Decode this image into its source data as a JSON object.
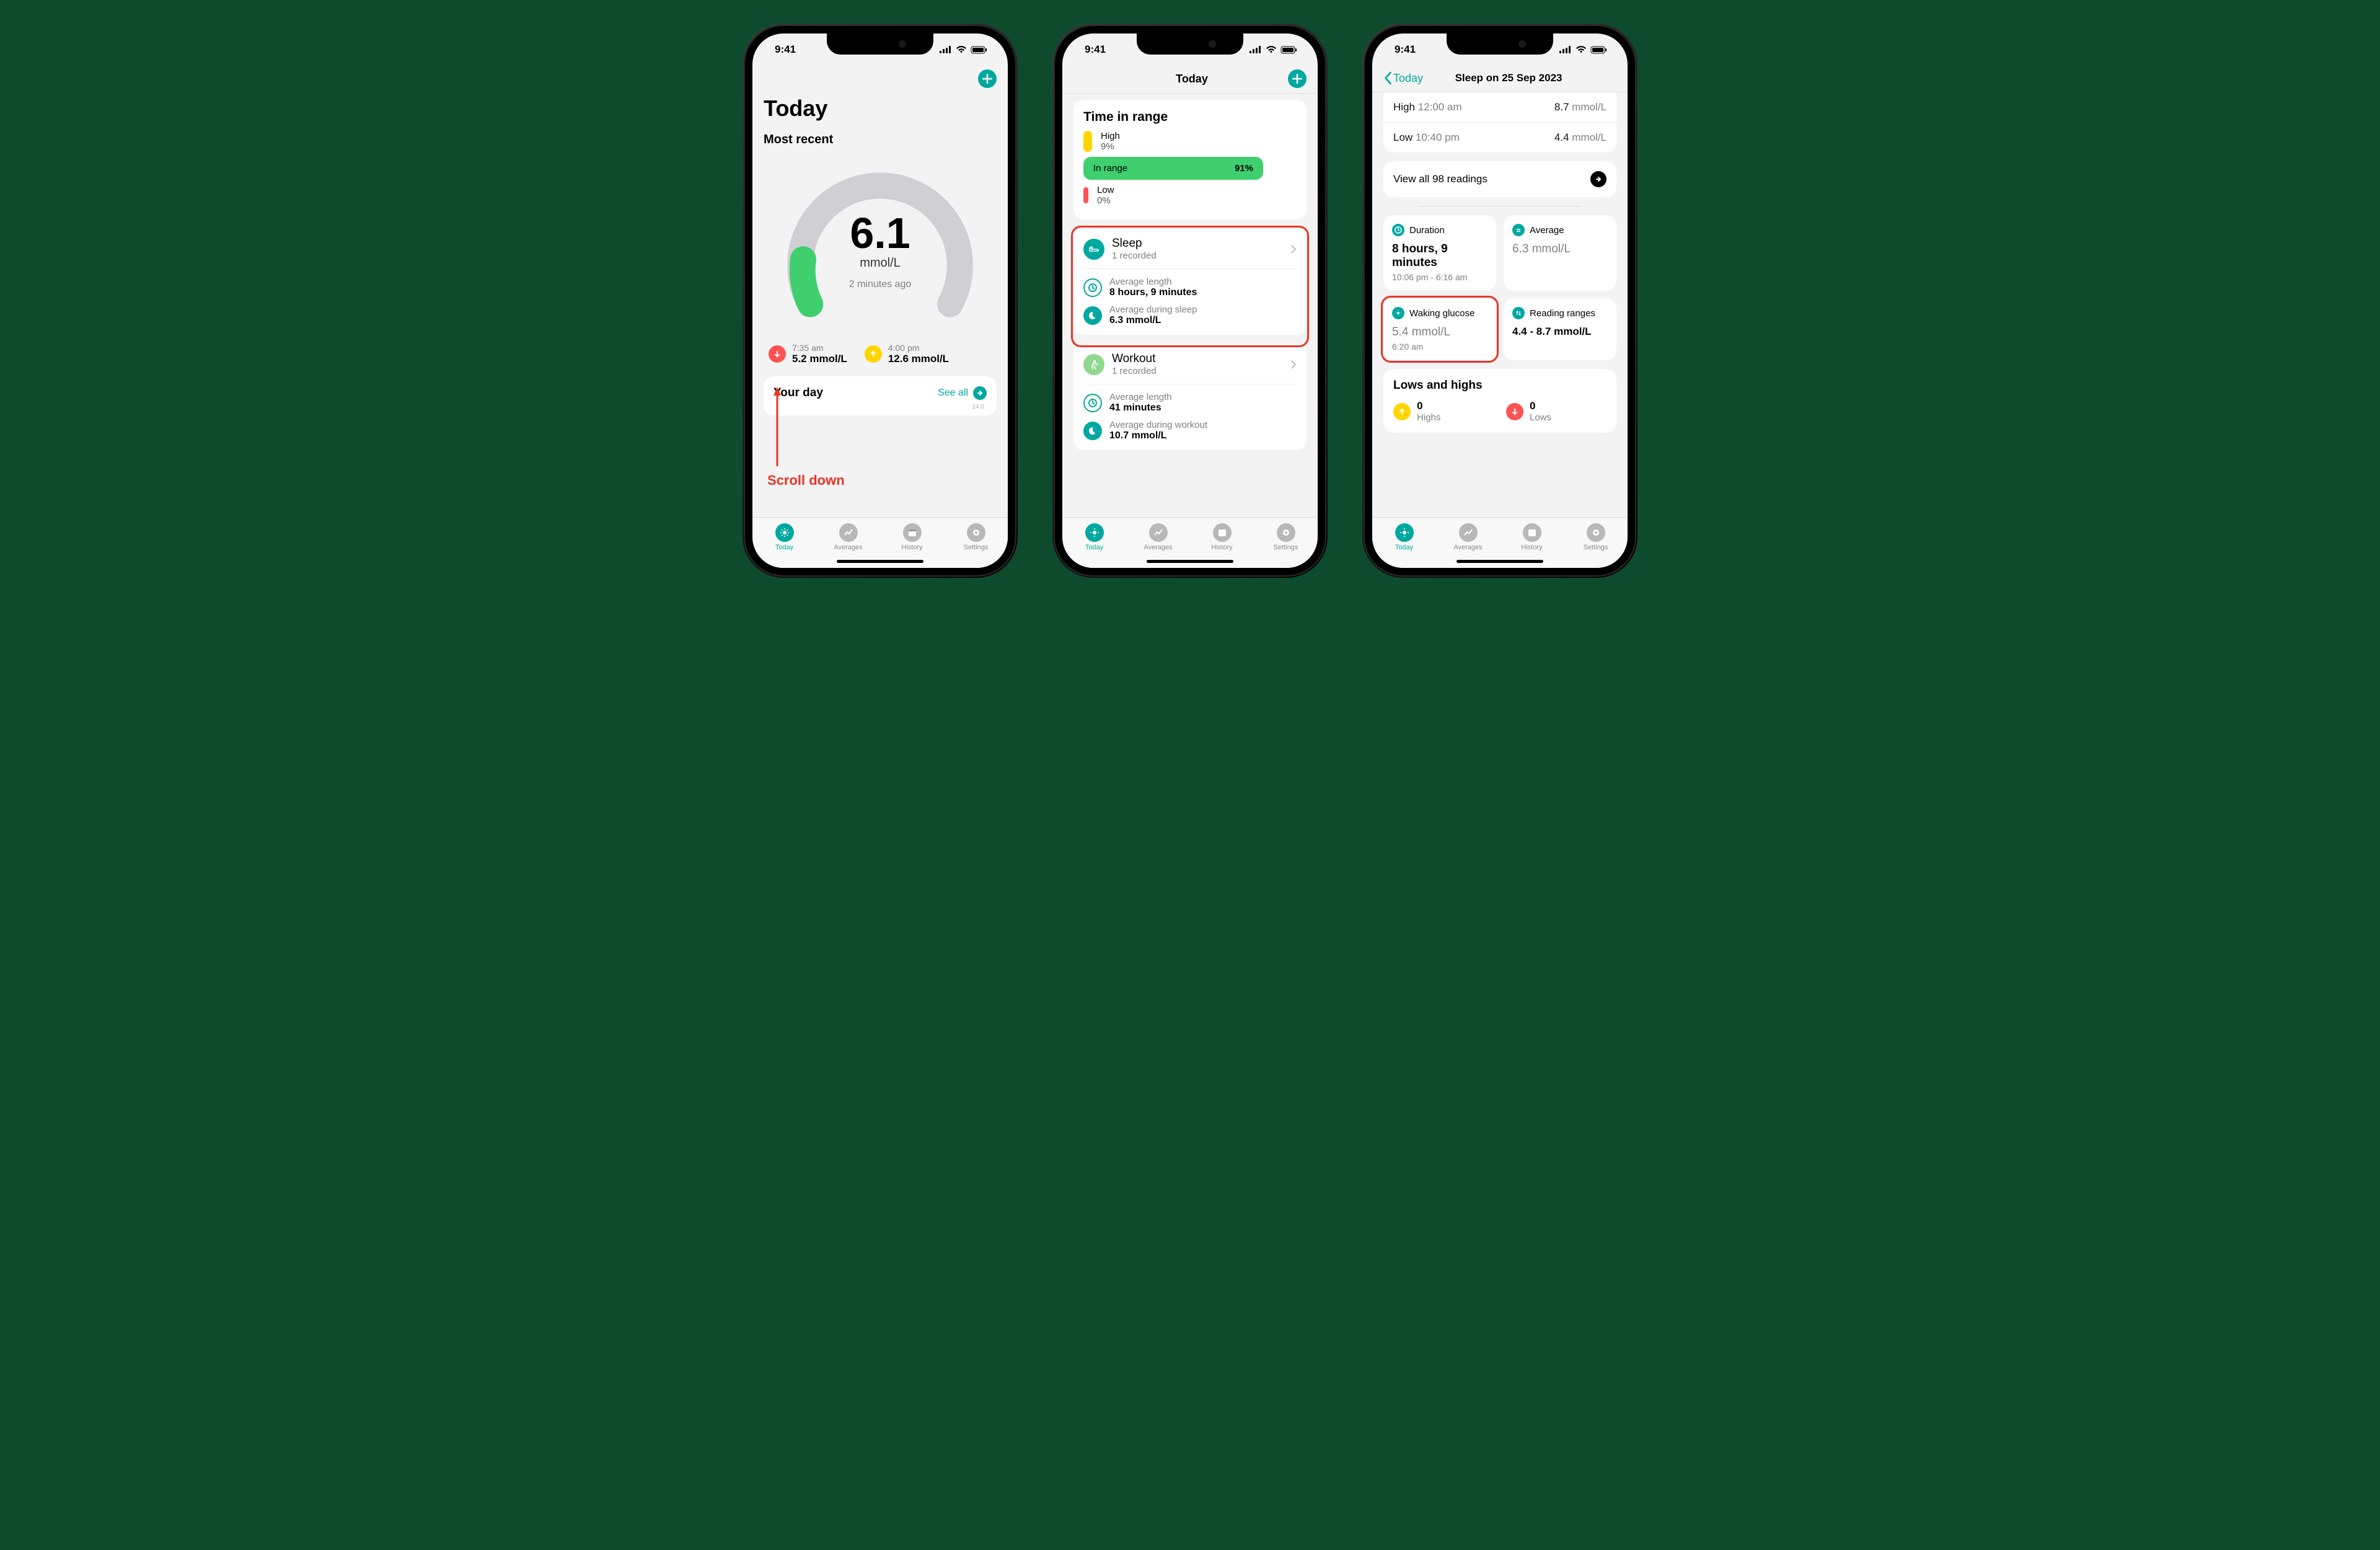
{
  "status": {
    "time": "9:41"
  },
  "tabs": [
    "Today",
    "Averages",
    "History",
    "Settings"
  ],
  "screen1": {
    "title": "Today",
    "section": "Most recent",
    "gauge": {
      "value": "6.1",
      "unit": "mmol/L",
      "ago": "2 minutes ago"
    },
    "low": {
      "time": "7:35 am",
      "value": "5.2 mmol/L"
    },
    "high": {
      "time": "4:00 pm",
      "value": "12.6 mmol/L"
    },
    "yourday": {
      "title": "Your day",
      "seeall": "See all",
      "axis": "14.0"
    },
    "hint": "Scroll down"
  },
  "screen2": {
    "title": "Today",
    "tir": {
      "title": "Time in range",
      "high_label": "High",
      "high_pct": "9%",
      "in_label": "In range",
      "in_pct": "91%",
      "low_label": "Low",
      "low_pct": "0%"
    },
    "sleep": {
      "title": "Sleep",
      "sub": "1 recorded",
      "avg_len_label": "Average length",
      "avg_len": "8 hours, 9 minutes",
      "avg_during_label": "Average during sleep",
      "avg_during": "6.3 mmol/L"
    },
    "workout": {
      "title": "Workout",
      "sub": "1 recorded",
      "avg_len_label": "Average length",
      "avg_len": "41 minutes",
      "avg_during_label": "Average during workout",
      "avg_during": "10.7 mmol/L"
    }
  },
  "screen3": {
    "back": "Today",
    "title": "Sleep on 25 Sep 2023",
    "rows": {
      "high_label": "High",
      "high_time": "12:00 am",
      "high_val": "8.7",
      "high_unit": "mmol/L",
      "low_label": "Low",
      "low_time": "10:40 pm",
      "low_val": "4.4",
      "low_unit": "mmol/L"
    },
    "viewall": "View all 98 readings",
    "stats": {
      "duration_label": "Duration",
      "duration_val": "8 hours, 9 minutes",
      "duration_sub": "10:06 pm - 6:16 am",
      "average_label": "Average",
      "average_val": "6.3",
      "average_unit": "mmol/L",
      "waking_label": "Waking glucose",
      "waking_val": "5.4",
      "waking_unit": "mmol/L",
      "waking_sub": "6:20 am",
      "ranges_label": "Reading ranges",
      "ranges_val": "4.4 - 8.7 mmol/L"
    },
    "lowshighs": {
      "title": "Lows and highs",
      "highs_n": "0",
      "highs_l": "Highs",
      "lows_n": "0",
      "lows_l": "Lows"
    }
  }
}
